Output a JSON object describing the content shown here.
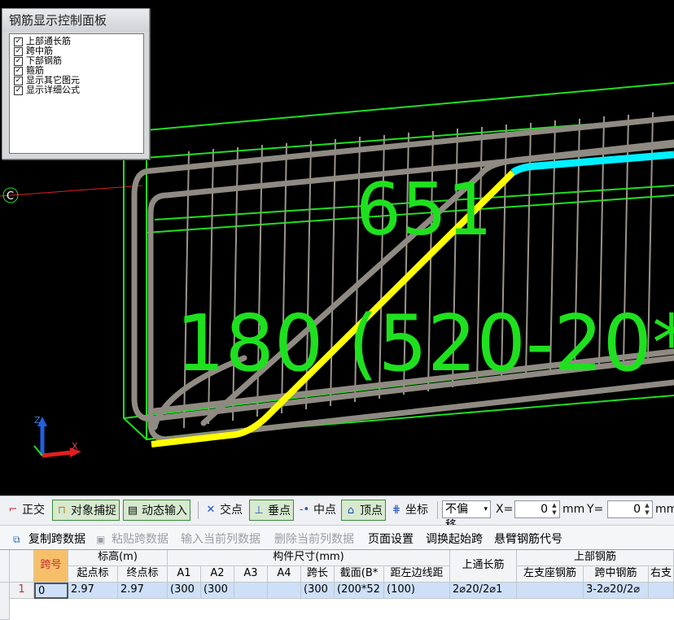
{
  "colors": {
    "beam_edge": "#1fe01f",
    "rebar": "#8f8a82",
    "bent_bar_highlight": "#ffff00",
    "top_bar_highlight": "#00f0ff",
    "axis_x": "#e02020",
    "axis_z": "#2060e0"
  },
  "viewport": {
    "dimension_text_1": "651",
    "dimension_text_2": "180 (520-20*",
    "grip_label": "C",
    "axis_labels": {
      "z": "Z",
      "x": "X"
    }
  },
  "control_panel": {
    "title": "钢筋显示控制面板",
    "items": [
      {
        "label": "上部通长筋",
        "checked": true
      },
      {
        "label": "跨中筋",
        "checked": true
      },
      {
        "label": "下部钢筋",
        "checked": true
      },
      {
        "label": "箍筋",
        "checked": true
      },
      {
        "label": "显示其它图元",
        "checked": true
      },
      {
        "label": "显示详细公式",
        "checked": true
      }
    ]
  },
  "toolbar": {
    "ortho": "正交",
    "snap": "对象捕捉",
    "dynamic_input": "动态输入",
    "intersection": "交点",
    "perpendicular": "垂点",
    "midpoint": "中点",
    "vertex": "顶点",
    "coordinate": "坐标",
    "offset_select": "不偏移",
    "x_label": "X=",
    "x_value": "0",
    "x_unit": "mm",
    "y_label": "Y=",
    "y_value": "0",
    "y_unit": "mm"
  },
  "actionbar": {
    "copy_span": "复制跨数据",
    "paste_span": "粘贴跨数据",
    "input_column": "输入当前列数据",
    "delete_column": "删除当前列数据",
    "page_setup": "页面设置",
    "swap_start": "调换起始跨",
    "cantilever_code": "悬臂钢筋代号"
  },
  "grid": {
    "headers": {
      "span_no": "跨号",
      "elevation": "标高(m)",
      "start_elev": "起点标",
      "end_elev": "终点标",
      "dims": "构件尺寸(mm)",
      "a1": "A1",
      "a2": "A2",
      "a3": "A3",
      "a4": "A4",
      "span_len": "跨长",
      "section": "截面(B*",
      "dist_left": "距左边线距",
      "top_long": "上通长筋",
      "top_rebar": "上部钢筋",
      "left_support": "左支座钢筋",
      "mid_span": "跨中钢筋",
      "right_support": "右支"
    },
    "rows": [
      {
        "row_no": "1",
        "span_no": "0",
        "start_elev": "2.97",
        "end_elev": "2.97",
        "a1": "(300",
        "a2": "(300",
        "a3": "",
        "a4": "",
        "span_len": "(300",
        "section": "(200*52",
        "dist_left": "(100)",
        "top_long": "2⌀20/2⌀1",
        "left_support": "",
        "mid_span": "3-2⌀20/2⌀",
        "right_support": ""
      }
    ]
  }
}
